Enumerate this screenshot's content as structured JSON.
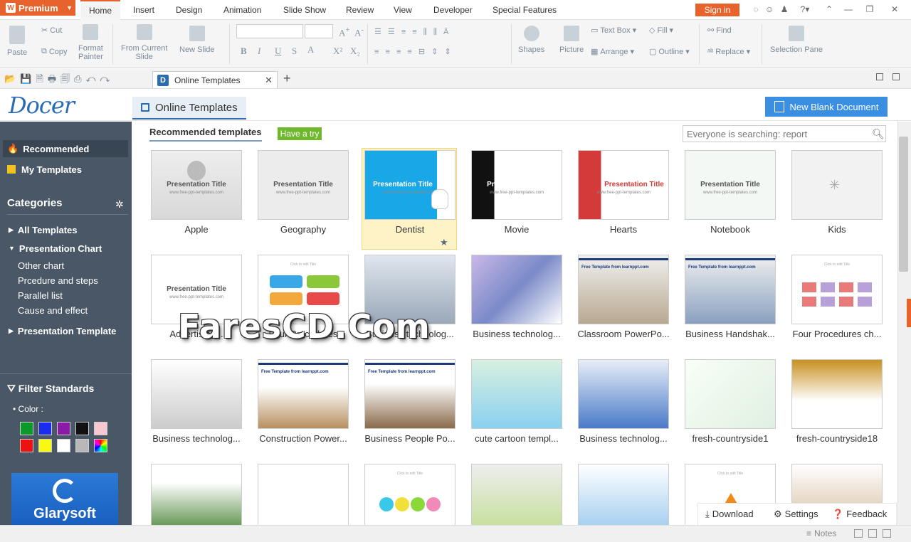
{
  "menubar": {
    "premium": "Premium",
    "tabs": [
      "Home",
      "Insert",
      "Design",
      "Animation",
      "Slide Show",
      "Review",
      "View",
      "Developer",
      "Special Features"
    ],
    "signin": "Sign in"
  },
  "ribbon": {
    "paste": "Paste",
    "cut": "Cut",
    "copy": "Copy",
    "format_painter": [
      "Format",
      "Painter"
    ],
    "from_current_slide": [
      "From Current",
      "Slide"
    ],
    "new_slide": "New Slide",
    "shapes": "Shapes",
    "picture": "Picture",
    "text_box": "Text Box",
    "arrange": "Arrange",
    "fill": "Fill",
    "outline": "Outline",
    "find": "Find",
    "replace": "Replace",
    "selection_pane": "Selection Pane"
  },
  "tabbar": {
    "doc_tab": "Online Templates"
  },
  "header": {
    "logo": "Docer",
    "online_tab": "Online Templates",
    "new_blank": "New Blank Document"
  },
  "sidebar": {
    "recommended": "Recommended",
    "my_templates": "My Templates",
    "categories": "Categories",
    "cat_items": {
      "all": "All Templates",
      "presentation_chart": "Presentation Chart",
      "other_chart": "Other chart",
      "procedure": "Prcedure and steps",
      "parallel": "Parallel list",
      "cause": "Cause and effect",
      "presentation_template": "Presentation Template"
    },
    "filter": "Filter Standards",
    "color_label": "• Color :",
    "colors": [
      "#0a9a2a",
      "#1a2cf0",
      "#8a1aa8",
      "#111111",
      "#f8c8d0",
      "#ee1111",
      "#f8f810",
      "#ffffff",
      "#b8b8b8",
      "rainbow"
    ],
    "ad_text": "Glarysoft"
  },
  "content": {
    "recommended_templates": "Recommended templates",
    "have_a_try": "Have a try",
    "search_placeholder": "Everyone is searching: report",
    "rows": [
      [
        "Apple",
        "Geography",
        "Dentist",
        "Movie",
        "Hearts",
        "Notebook",
        "Kids"
      ],
      [
        "Advertising...",
        "Four Procedures",
        "Business technolog...",
        "Business technolog...",
        "Classroom PowerPo...",
        "Business Handshak...",
        "Four Procedures ch..."
      ],
      [
        "Business technolog...",
        "Construction Power...",
        "Business People Po...",
        "cute cartoon templ...",
        "Business technolog...",
        "fresh-countryside1",
        "fresh-countryside18"
      ]
    ],
    "thumb_title": "Presentation Title",
    "thumb_url": "www.free-ppt-templates.com",
    "thumb_free": "Free Template from learnppt.com",
    "thumb_click": "Click to edit Title"
  },
  "watermark": "FaresCD.Com",
  "bottom": {
    "download": "Download",
    "settings": "Settings",
    "feedback": "Feedback",
    "notes": "Notes"
  }
}
